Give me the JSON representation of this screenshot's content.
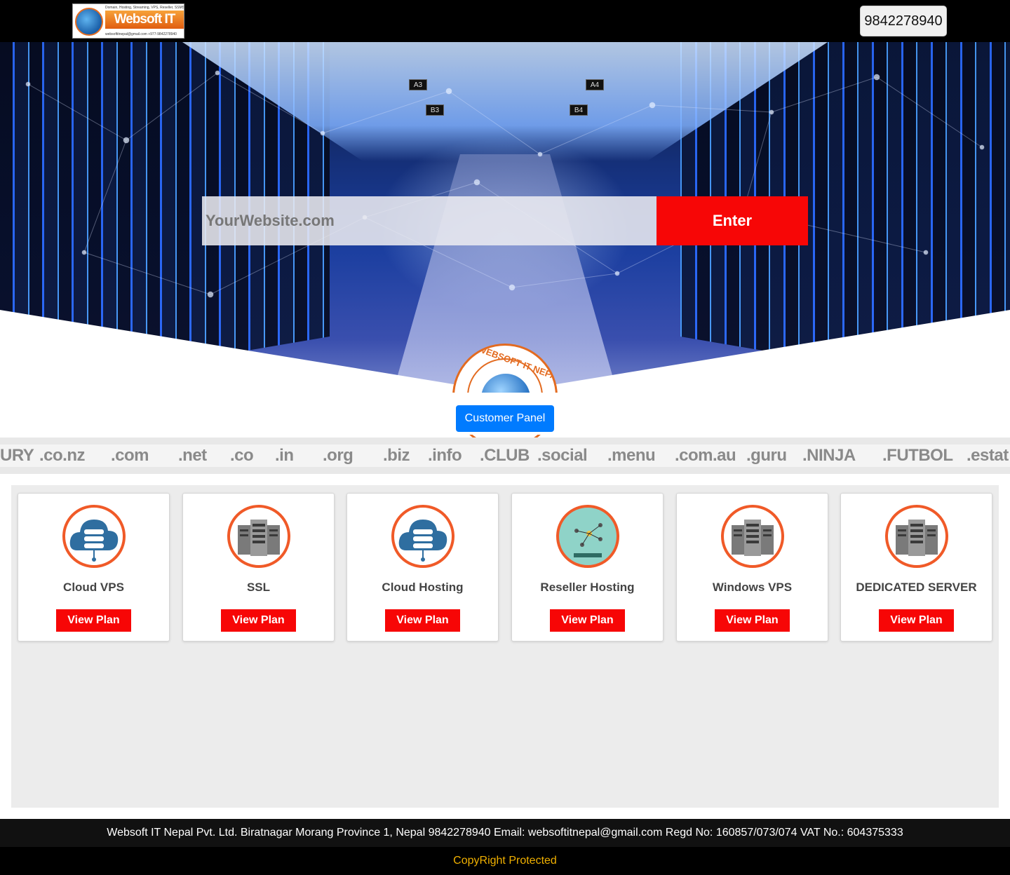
{
  "header": {
    "logo": {
      "name": "Websoft IT Nepal",
      "tagline": "Domain, Hosting, Streaming, VPS, Reseller, SSMS Provider",
      "contact": "websoftitnepal@gmail.com  +977-9842278940"
    },
    "phone": "9842278940"
  },
  "hero": {
    "search_placeholder": "YourWebsite.com",
    "enter_label": "Enter",
    "seal_text": "WEBSOFT IT NEPAL",
    "signs": [
      "A3",
      "A4",
      "B3",
      "B4"
    ]
  },
  "customer_panel_label": "Customer Panel",
  "tlds": [
    "URY",
    ".co.nz",
    ".com",
    ".net",
    ".co",
    ".in",
    ".org",
    ".biz",
    ".info",
    ".CLUB",
    ".social",
    ".menu",
    ".com.au",
    ".guru",
    ".NINJA",
    ".FUTBOL",
    ".estat"
  ],
  "products": [
    {
      "title": "Cloud VPS",
      "icon": "cloud-server-icon",
      "button": "View Plan"
    },
    {
      "title": "SSL",
      "icon": "server-rack-icon",
      "button": "View Plan"
    },
    {
      "title": "Cloud Hosting",
      "icon": "cloud-server-icon",
      "button": "View Plan"
    },
    {
      "title": "Reseller Hosting",
      "icon": "reseller-network-icon",
      "button": "View Plan"
    },
    {
      "title": "Windows VPS",
      "icon": "server-rack-icon",
      "button": "View Plan"
    },
    {
      "title": "DEDICATED SERVER",
      "icon": "server-rack-icon",
      "button": "View Plan"
    }
  ],
  "footer": {
    "info": "Websoft IT Nepal Pvt. Ltd. Biratnagar Morang Province 1, Nepal 9842278940 Email: websoftitnepal@gmail.com Regd No: 160857/073/074 VAT No.: 604375333",
    "copyright": "CopyRight Protected"
  },
  "colors": {
    "accent_red": "#f70606",
    "primary_blue": "#007bff",
    "icon_ring": "#f05a28",
    "copyright_gold": "#f0b000"
  }
}
